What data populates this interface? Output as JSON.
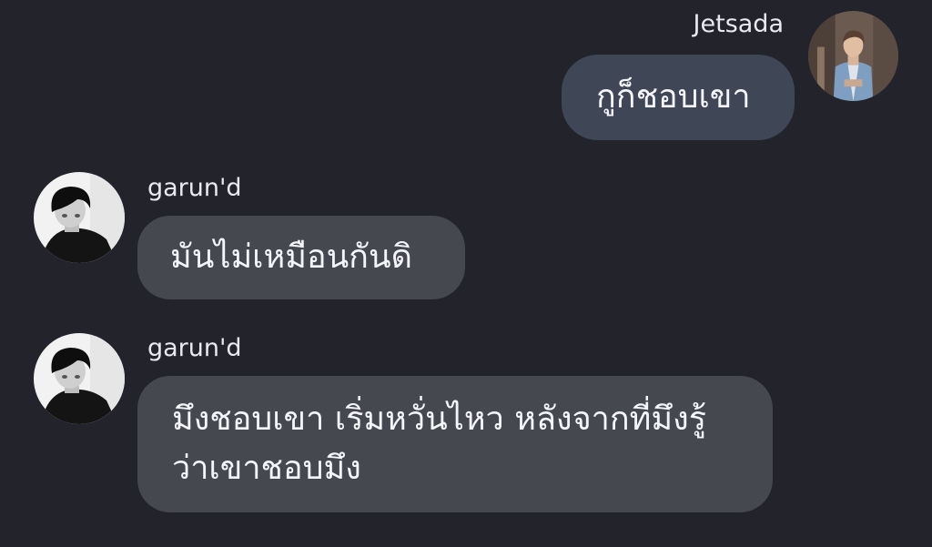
{
  "messages": [
    {
      "sender": "Jetsada",
      "direction": "outgoing",
      "lines": [
        "กูก็ชอบเขา"
      ],
      "avatar": "person-denim-jacket-avatar"
    },
    {
      "sender": "garun'd",
      "direction": "incoming",
      "lines": [
        "มันไม่เหมือนกันดิ"
      ],
      "avatar": "person-black-white-avatar"
    },
    {
      "sender": "garun'd",
      "direction": "incoming",
      "lines": [
        "มึงชอบเขา เริ่มหวั่นไหว หลังจากที่มึงรู้",
        "ว่าเขาชอบมึง"
      ],
      "avatar": "person-black-white-avatar"
    }
  ],
  "colors": {
    "background": "#22232b",
    "outgoing_bubble": "#3f4656",
    "incoming_bubble": "#464850",
    "text": "#f4f5f8"
  }
}
